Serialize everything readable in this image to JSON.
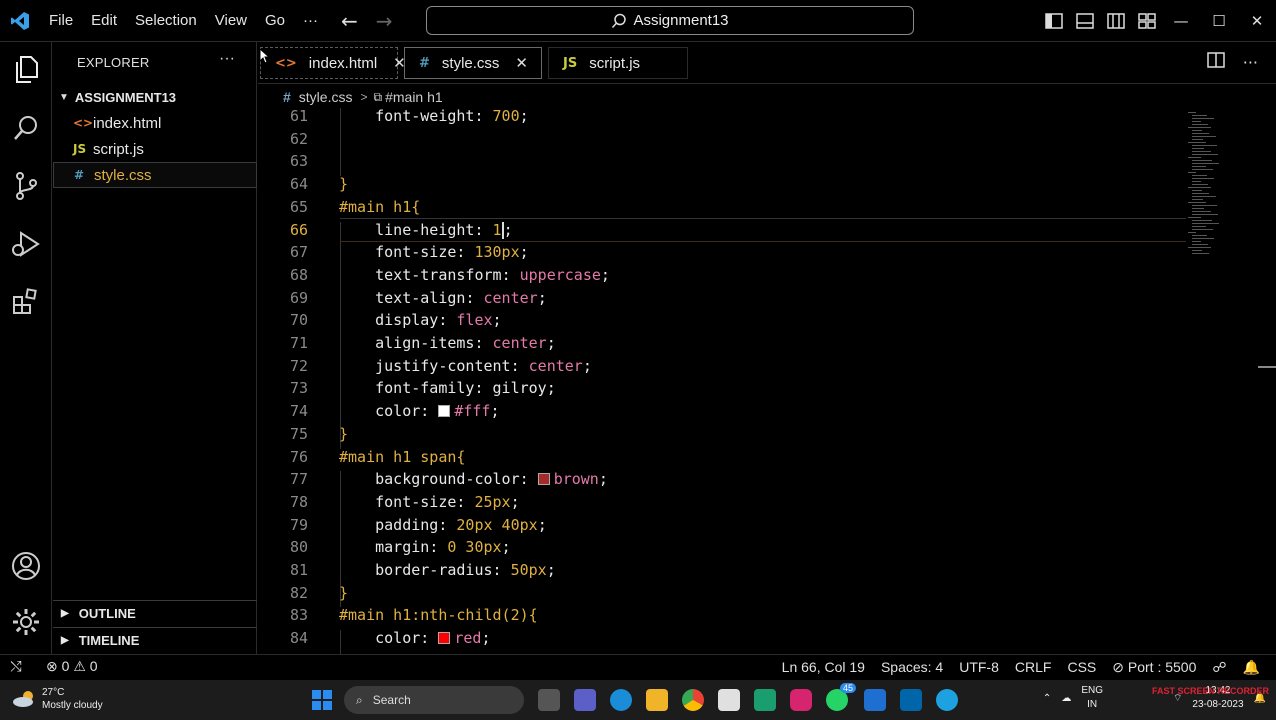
{
  "titlebar": {
    "menu": [
      "File",
      "Edit",
      "Selection",
      "View",
      "Go"
    ],
    "more": "···",
    "search": "Assignment13"
  },
  "explorer": {
    "title": "EXPLORER",
    "more": "···",
    "folder": "ASSIGNMENT13",
    "files": [
      {
        "name": "index.html",
        "icon": "<>",
        "color": "#e37933"
      },
      {
        "name": "script.js",
        "icon": "JS",
        "color": "#cbcb41"
      },
      {
        "name": "style.css",
        "icon": "#",
        "color": "#519aba"
      }
    ],
    "outline": "OUTLINE",
    "timeline": "TIMELINE"
  },
  "tabs": [
    {
      "name": "index.html",
      "icon": "<>",
      "color": "#e37933",
      "close": "✕"
    },
    {
      "name": "style.css",
      "icon": "#",
      "color": "#519aba",
      "close": "✕"
    },
    {
      "name": "script.js",
      "icon": "JS",
      "color": "#cbcb41",
      "close": ""
    }
  ],
  "breadcrumb": {
    "file": "style.css",
    "symbol": "#main h1"
  },
  "editor": {
    "current_line": 66,
    "lines": [
      {
        "n": "61",
        "indent": 1,
        "prop": "font-weight",
        "val": "700"
      },
      {
        "n": "62",
        "indent": 0
      },
      {
        "n": "63",
        "indent": 0
      },
      {
        "n": "64",
        "indent": 0,
        "raw": "}"
      },
      {
        "n": "65",
        "indent": 0,
        "sel": "#main h1",
        "open": "{"
      },
      {
        "n": "66",
        "indent": 1,
        "prop": "line-height",
        "val": "1",
        "cursor": true
      },
      {
        "n": "67",
        "indent": 1,
        "prop": "font-size",
        "val": "130px"
      },
      {
        "n": "68",
        "indent": 1,
        "prop": "text-transform",
        "kw": "uppercase"
      },
      {
        "n": "69",
        "indent": 1,
        "prop": "text-align",
        "kw": "center"
      },
      {
        "n": "70",
        "indent": 1,
        "prop": "display",
        "kw": "flex"
      },
      {
        "n": "71",
        "indent": 1,
        "prop": "align-items",
        "kw": "center"
      },
      {
        "n": "72",
        "indent": 1,
        "prop": "justify-content",
        "kw": "center"
      },
      {
        "n": "73",
        "indent": 1,
        "prop": "font-family",
        "plain": "gilroy"
      },
      {
        "n": "74",
        "indent": 1,
        "prop": "color",
        "swatch": "#ffffff",
        "kw": "#fff"
      },
      {
        "n": "75",
        "indent": 0,
        "raw": "}"
      },
      {
        "n": "76",
        "indent": 0,
        "sel": "#main h1 span",
        "open": "{"
      },
      {
        "n": "77",
        "indent": 1,
        "prop": "background-color",
        "swatch": "#a52a2a",
        "kw": "brown"
      },
      {
        "n": "78",
        "indent": 1,
        "prop": "font-size",
        "val": "25px"
      },
      {
        "n": "79",
        "indent": 1,
        "prop": "padding",
        "val": "20px 40px"
      },
      {
        "n": "80",
        "indent": 1,
        "prop": "margin",
        "val": "0 30px"
      },
      {
        "n": "81",
        "indent": 1,
        "prop": "border-radius",
        "val": "50px"
      },
      {
        "n": "82",
        "indent": 0,
        "raw": "}"
      },
      {
        "n": "83",
        "indent": 0,
        "sel": "#main h1:nth-child(2)",
        "open": "{"
      },
      {
        "n": "84",
        "indent": 1,
        "prop": "color",
        "swatch": "#ff0000",
        "kw": "red"
      }
    ]
  },
  "status": {
    "errors": "0",
    "warnings": "0",
    "position": "Ln 66, Col 19",
    "spaces": "Spaces: 4",
    "encoding": "UTF-8",
    "eol": "CRLF",
    "language": "CSS",
    "port": "Port : 5500"
  },
  "taskbar": {
    "temp": "27°C",
    "weather": "Mostly cloudy",
    "search": "Search",
    "lang1": "ENG",
    "lang2": "IN",
    "time": "13:42",
    "date": "23-08-2023",
    "badge": "45"
  },
  "watermark": "FAST SCREEN RECORDER",
  "colors": {
    "accent": "#e0b040",
    "keyword": "#e47aa8"
  }
}
